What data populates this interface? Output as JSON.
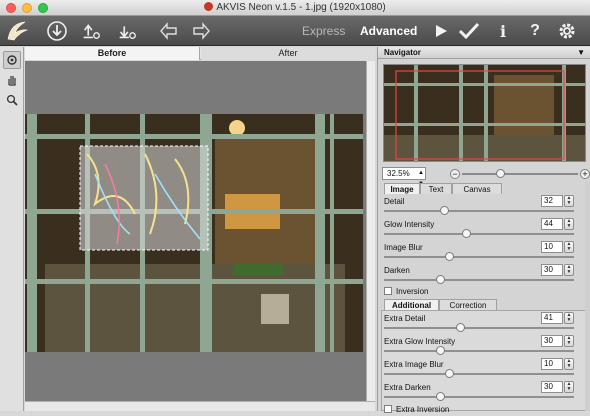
{
  "window": {
    "title": "AKVIS Neon v.1.5 - 1.jpg (1920x1080)"
  },
  "toolbar": {
    "icons": [
      "app-logo-icon",
      "open-image-icon",
      "save-image-icon",
      "print-settings-icon",
      "undo-icon",
      "redo-icon"
    ],
    "modes": {
      "express": "Express",
      "advanced": "Advanced"
    },
    "right_icons": [
      "run-icon",
      "apply-icon",
      "info-icon",
      "help-icon",
      "settings-gear-icon"
    ]
  },
  "tools": [
    "hand-icon",
    "zoom-icon",
    "navigator-hand-icon"
  ],
  "view_tabs": {
    "before": "Before",
    "after": "After"
  },
  "navigator": {
    "title": "Navigator",
    "zoom": "32.5%",
    "zoom_slider_fraction": 0.33
  },
  "settings": {
    "tabs": {
      "image": "Image",
      "text": "Text",
      "canvas": "Canvas"
    },
    "params": [
      {
        "label": "Detail",
        "value": "32",
        "level": 0.32
      },
      {
        "label": "Glow Intensity",
        "value": "44",
        "level": 0.44
      },
      {
        "label": "Image Blur",
        "value": "10",
        "level": 0.35
      },
      {
        "label": "Darken",
        "value": "30",
        "level": 0.3
      }
    ],
    "inversion_label": "Inversion",
    "sub_tabs": {
      "additional": "Additional",
      "correction": "Correction"
    },
    "extra_params": [
      {
        "label": "Extra Detail",
        "value": "41",
        "level": 0.41
      },
      {
        "label": "Extra Glow Intensity",
        "value": "30",
        "level": 0.3
      },
      {
        "label": "Extra Image Blur",
        "value": "10",
        "level": 0.35
      },
      {
        "label": "Extra Darken",
        "value": "30",
        "level": 0.3
      }
    ],
    "extra_inversion_label": "Extra Inversion"
  },
  "colors": {
    "toolbar": "#4f4f4f",
    "panel": "#d4d4d4",
    "canvas_bg": "#7a7a7a",
    "frame": "#9bb1a0"
  }
}
